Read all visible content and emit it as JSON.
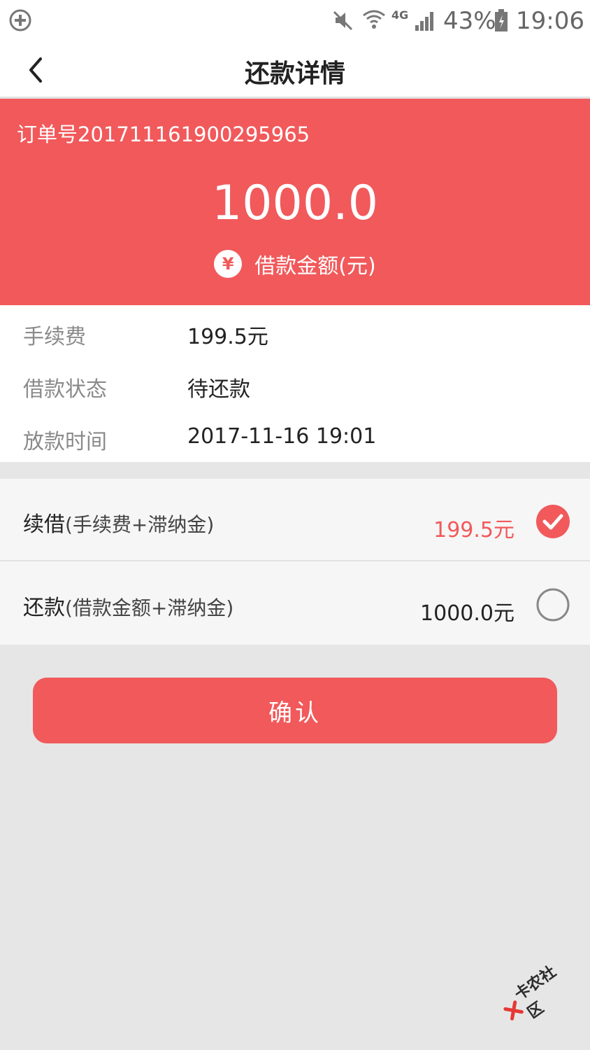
{
  "status_bar": {
    "network": "4G",
    "battery": "43%",
    "time": "19:06"
  },
  "nav": {
    "title": "还款详情"
  },
  "summary": {
    "order_number": "订单号201711161900295965",
    "amount": "1000.0",
    "amount_caption": "借款金额(元)",
    "currency_symbol": "¥"
  },
  "details": [
    {
      "label": "手续费",
      "value": "199.5元"
    },
    {
      "label": "借款状态",
      "value": "待还款"
    },
    {
      "label": "放款时间",
      "value": "2017-11-16 19:01"
    }
  ],
  "options": [
    {
      "name": "续借",
      "hint": "(手续费+滞纳金)",
      "price": "199.5元",
      "selected": true
    },
    {
      "name": "还款",
      "hint": "(借款金额+滞纳金)",
      "price": "1000.0元",
      "selected": false
    }
  ],
  "confirm_label": "确认",
  "watermark": "卡农社区",
  "colors": {
    "accent": "#f1595b",
    "background": "#e6e6e6"
  }
}
